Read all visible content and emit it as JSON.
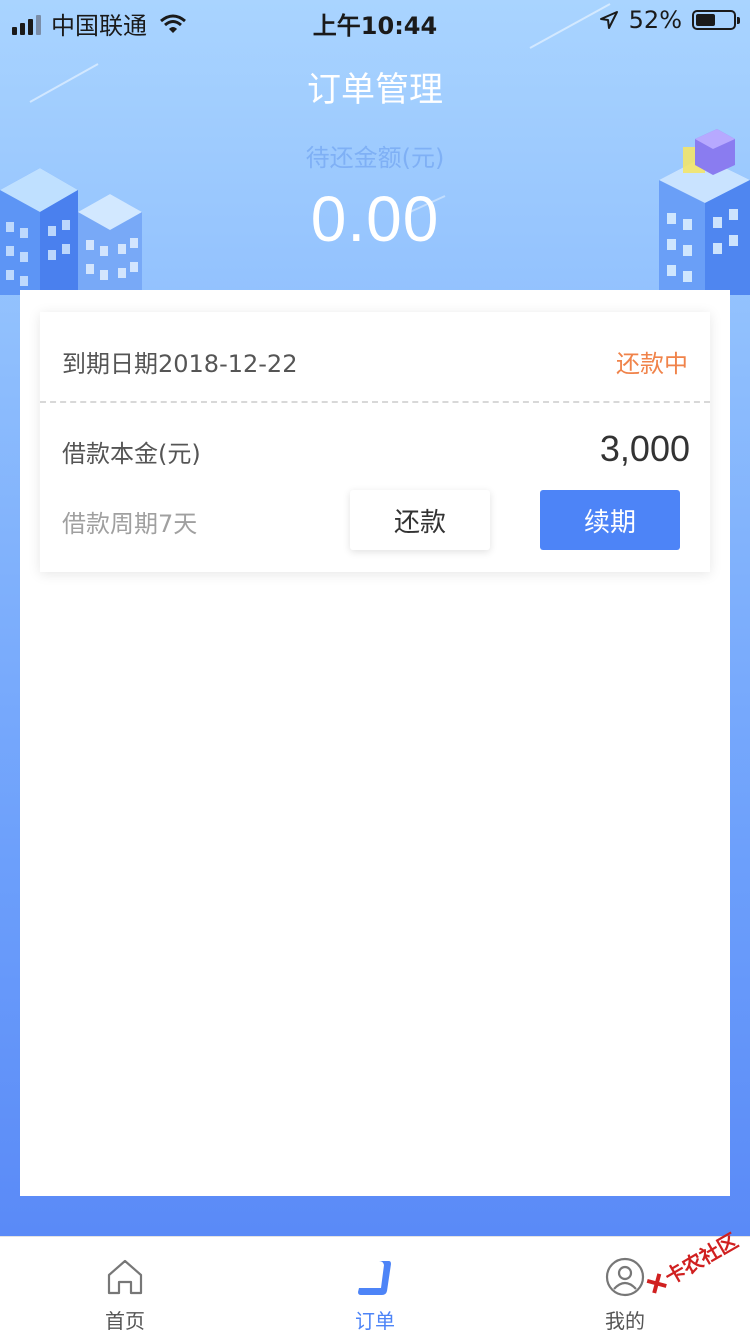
{
  "status_bar": {
    "carrier": "中国联通",
    "time": "上午10:44",
    "battery_percent": "52%",
    "battery_level": 0.52
  },
  "header": {
    "title": "订单管理",
    "amount_label": "待还金额(元)",
    "amount": "0.00"
  },
  "order": {
    "due_label": "到期日期2018-12-22",
    "status": "还款中",
    "principal_label": "借款本金(元)",
    "principal_value": "3,000",
    "period_label": "借款周期7天",
    "repay_button": "还款",
    "renew_button": "续期"
  },
  "tabbar": {
    "items": [
      {
        "label": "首页",
        "icon": "home-icon",
        "active": false
      },
      {
        "label": "订单",
        "icon": "order-icon",
        "active": true
      },
      {
        "label": "我的",
        "icon": "profile-icon",
        "active": false
      }
    ]
  },
  "watermark": {
    "text": "卡农社区"
  },
  "colors": {
    "accent": "#4d84f7",
    "status_orange": "#f0834a",
    "header_gradient_top": "#a9d4ff",
    "header_gradient_bottom": "#5a8af7"
  }
}
